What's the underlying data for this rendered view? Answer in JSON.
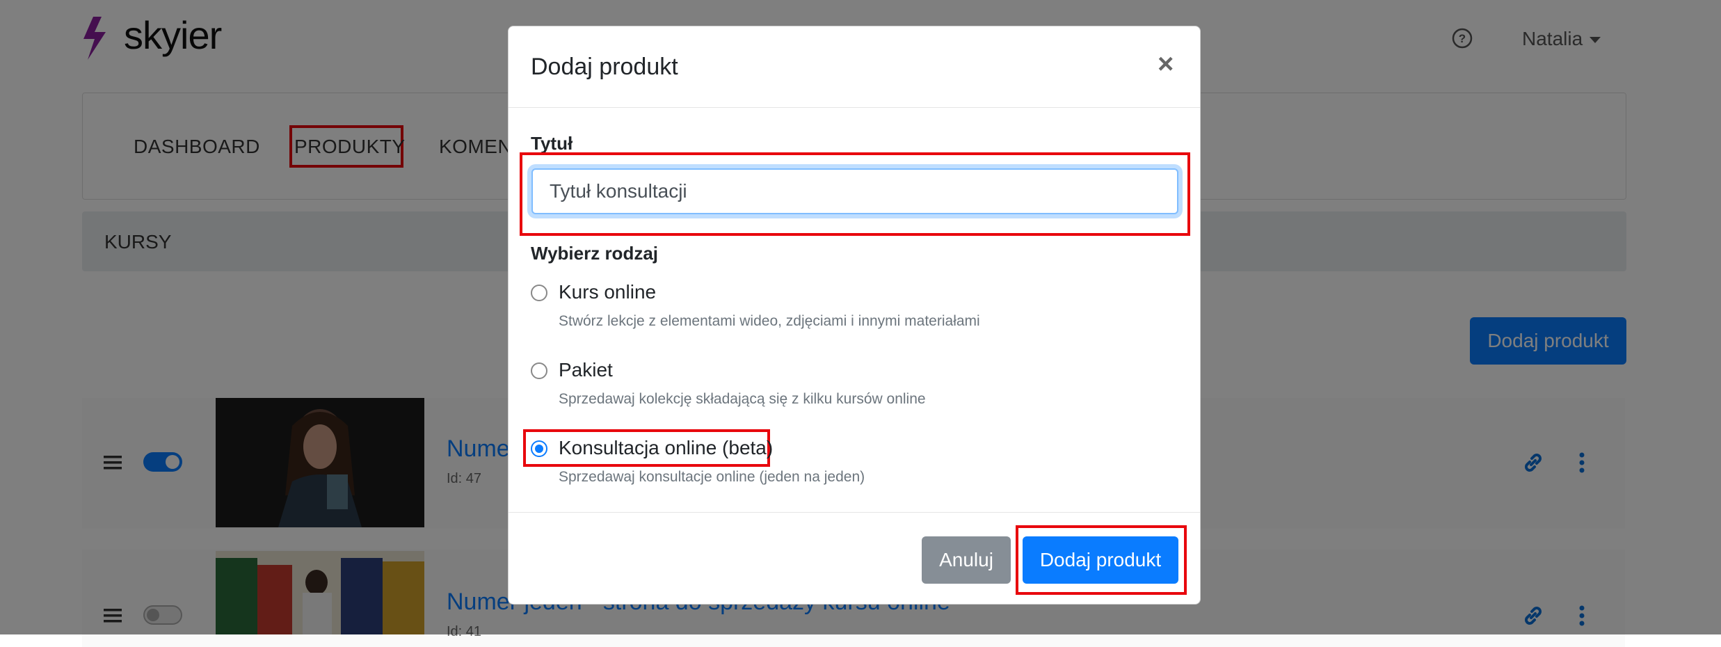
{
  "app": {
    "logo_text": "skyier",
    "user_name": "Natalia"
  },
  "nav": {
    "items": [
      "DASHBOARD",
      "PRODUKTY",
      "KOMEN"
    ]
  },
  "subnav": {
    "label": "KURSY"
  },
  "page": {
    "add_button": "Dodaj produkt"
  },
  "products": [
    {
      "title": "Nume",
      "id_label": "Id: 47",
      "enabled": true
    },
    {
      "title": "Numer jeden - strona do sprzedaży kursu online",
      "id_label": "Id: 41",
      "enabled": false
    }
  ],
  "modal": {
    "title": "Dodaj produkt",
    "close": "×",
    "title_label": "Tytuł",
    "title_value": "Tytuł konsultacji",
    "type_label": "Wybierz rodzaj",
    "options": [
      {
        "label": "Kurs online",
        "help": "Stwórz lekcje z elementami wideo, zdjęciami i innymi materiałami",
        "checked": false
      },
      {
        "label": "Pakiet",
        "help": "Sprzedawaj kolekcję składającą się z kilku kursów online",
        "checked": false
      },
      {
        "label": "Konsultacja online (beta)",
        "help": "Sprzedawaj konsultacje online (jeden na jeden)",
        "checked": true
      }
    ],
    "cancel": "Anuluj",
    "submit": "Dodaj produkt"
  },
  "colors": {
    "accent": "#0a7cff",
    "highlight": "#e8070d",
    "logo": "#8a1f9e"
  },
  "icons": [
    "bolt-logo-icon",
    "help-icon",
    "caret-down-icon",
    "drag-handle-icon",
    "link-icon",
    "kebab-menu-icon",
    "close-icon"
  ]
}
